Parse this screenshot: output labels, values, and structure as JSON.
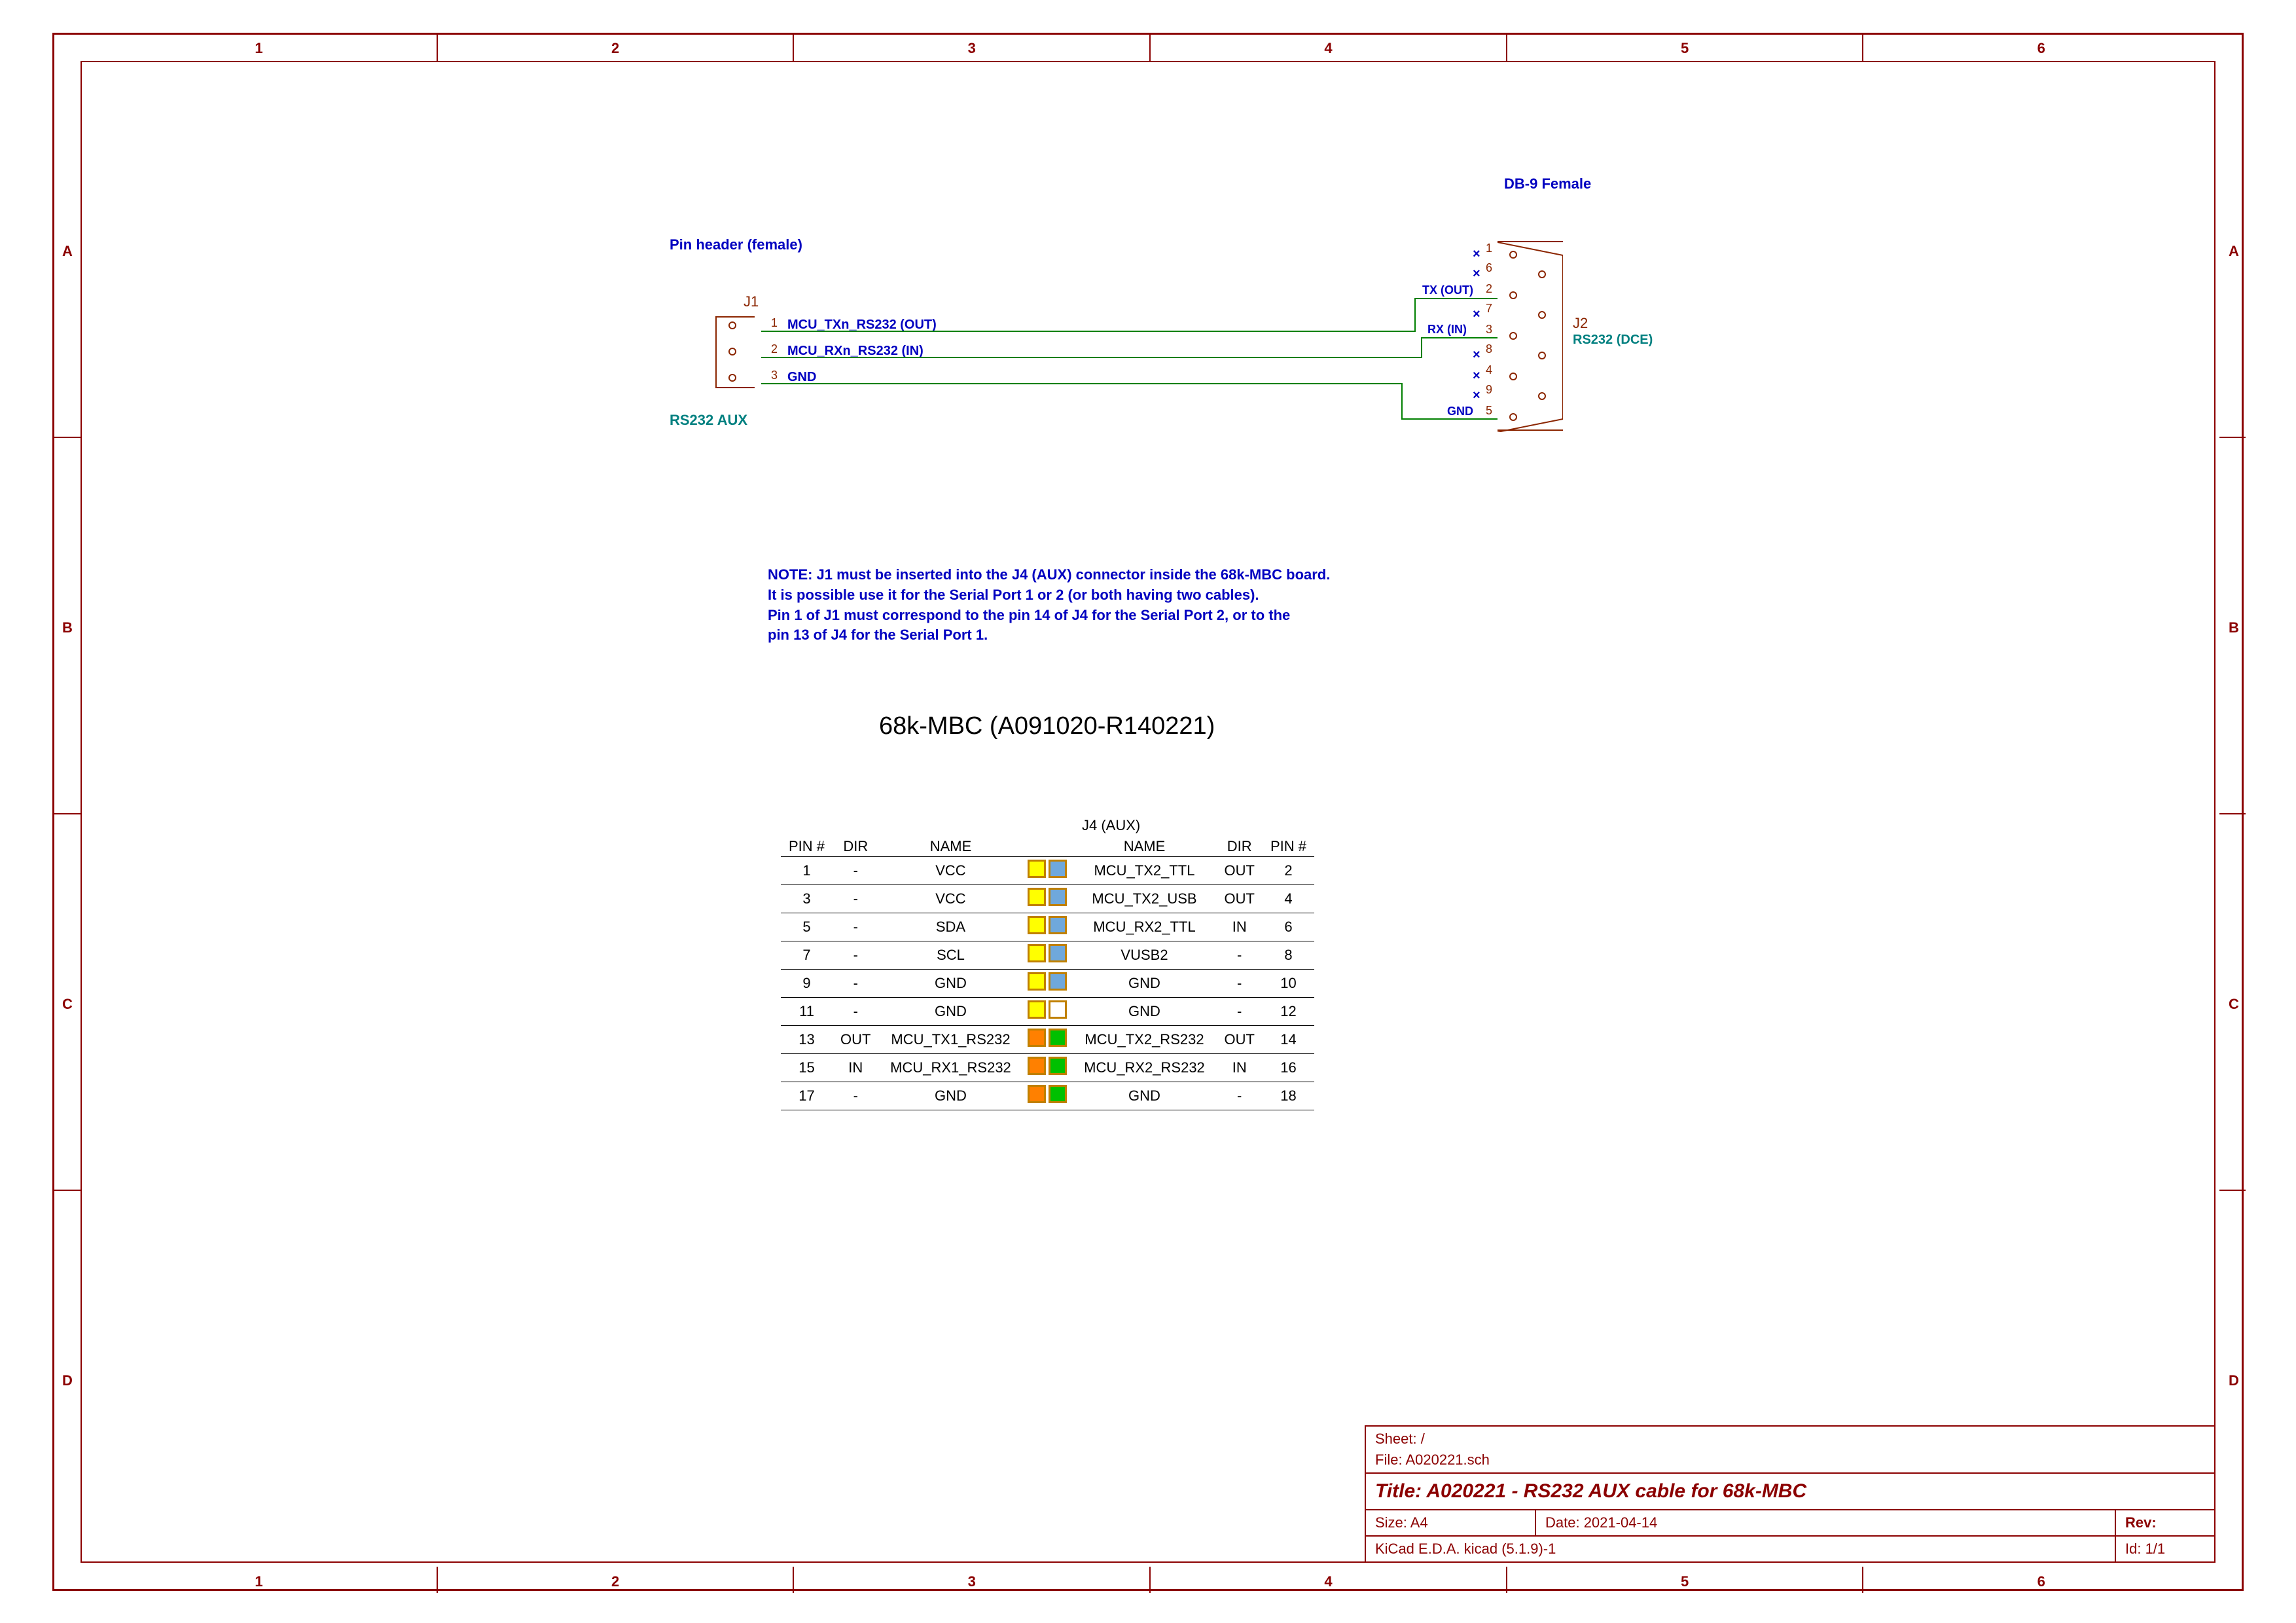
{
  "frame": {
    "top_nums": [
      "1",
      "2",
      "3",
      "4",
      "5",
      "6"
    ],
    "bot_nums": [
      "1",
      "2",
      "3",
      "4",
      "5",
      "6"
    ],
    "left_letters": [
      "A",
      "B",
      "C",
      "D"
    ],
    "right_letters": [
      "A",
      "B",
      "C",
      "D"
    ]
  },
  "schematic": {
    "pinheader_label": "Pin header (female)",
    "j1_label": "J1",
    "j1_name": "RS232 AUX",
    "j1_pins": [
      {
        "n": "1",
        "net": "MCU_TXn_RS232 (OUT)"
      },
      {
        "n": "2",
        "net": "MCU_RXn_RS232 (IN)"
      },
      {
        "n": "3",
        "net": "GND"
      }
    ],
    "db9_label": "DB-9 Female",
    "j2_label": "J2",
    "j2_name": "RS232 (DCE)",
    "j2_pins": [
      {
        "n": "1",
        "nc": true
      },
      {
        "n": "6",
        "nc": true
      },
      {
        "n": "2",
        "nc": false
      },
      {
        "n": "7",
        "nc": true
      },
      {
        "n": "3",
        "nc": false
      },
      {
        "n": "8",
        "nc": true
      },
      {
        "n": "4",
        "nc": true
      },
      {
        "n": "9",
        "nc": true
      },
      {
        "n": "5",
        "nc": false
      }
    ],
    "j2_signal_tx": "TX (OUT)",
    "j2_signal_rx": "RX (IN)",
    "j2_signal_gnd": "GND"
  },
  "note_lines": [
    "NOTE: J1 must be inserted into the J4 (AUX) connector inside the 68k-MBC board.",
    "It is possible use it for the Serial Port 1 or 2 (or both having two cables).",
    "Pin 1 of J1 must correspond to the pin 14 of J4 for the Serial Port 2, or to the",
    "pin 13 of J4 for the Serial Port 1."
  ],
  "heading": "68k-MBC (A091020-R140221)",
  "pinout": {
    "caption": "J4 (AUX)",
    "headers": [
      "PIN #",
      "DIR",
      "NAME",
      "",
      "",
      "NAME",
      "DIR",
      "PIN #"
    ],
    "rows": [
      {
        "l": [
          "1",
          "-",
          "VCC"
        ],
        "lc": "yellow",
        "rc": "blue",
        "r": [
          "MCU_TX2_TTL",
          "OUT",
          "2"
        ]
      },
      {
        "l": [
          "3",
          "-",
          "VCC"
        ],
        "lc": "yellow",
        "rc": "blue",
        "r": [
          "MCU_TX2_USB",
          "OUT",
          "4"
        ]
      },
      {
        "l": [
          "5",
          "-",
          "SDA"
        ],
        "lc": "yellow",
        "rc": "blue",
        "r": [
          "MCU_RX2_TTL",
          "IN",
          "6"
        ]
      },
      {
        "l": [
          "7",
          "-",
          "SCL"
        ],
        "lc": "yellow",
        "rc": "blue",
        "r": [
          "VUSB2",
          "-",
          "8"
        ]
      },
      {
        "l": [
          "9",
          "-",
          "GND"
        ],
        "lc": "yellow",
        "rc": "blue",
        "r": [
          "GND",
          "-",
          "10"
        ]
      },
      {
        "l": [
          "11",
          "-",
          "GND"
        ],
        "lc": "yellow",
        "rc": "white",
        "r": [
          "GND",
          "-",
          "12"
        ]
      },
      {
        "l": [
          "13",
          "OUT",
          "MCU_TX1_RS232"
        ],
        "lc": "orange",
        "rc": "green",
        "r": [
          "MCU_TX2_RS232",
          "OUT",
          "14"
        ]
      },
      {
        "l": [
          "15",
          "IN",
          "MCU_RX1_RS232"
        ],
        "lc": "orange",
        "rc": "green",
        "r": [
          "MCU_RX2_RS232",
          "IN",
          "16"
        ]
      },
      {
        "l": [
          "17",
          "-",
          "GND"
        ],
        "lc": "orange",
        "rc": "green",
        "r": [
          "GND",
          "-",
          "18"
        ]
      }
    ]
  },
  "title_block": {
    "sheet": "Sheet: /",
    "file": "File: A020221.sch",
    "title": "Title: A020221 - RS232 AUX cable for 68k-MBC",
    "size_label": "Size: A4",
    "date_label": "Date: 2021-04-14",
    "rev_label": "Rev:",
    "tool": "KiCad E.D.A.  kicad (5.1.9)-1",
    "id": "Id: 1/1"
  }
}
